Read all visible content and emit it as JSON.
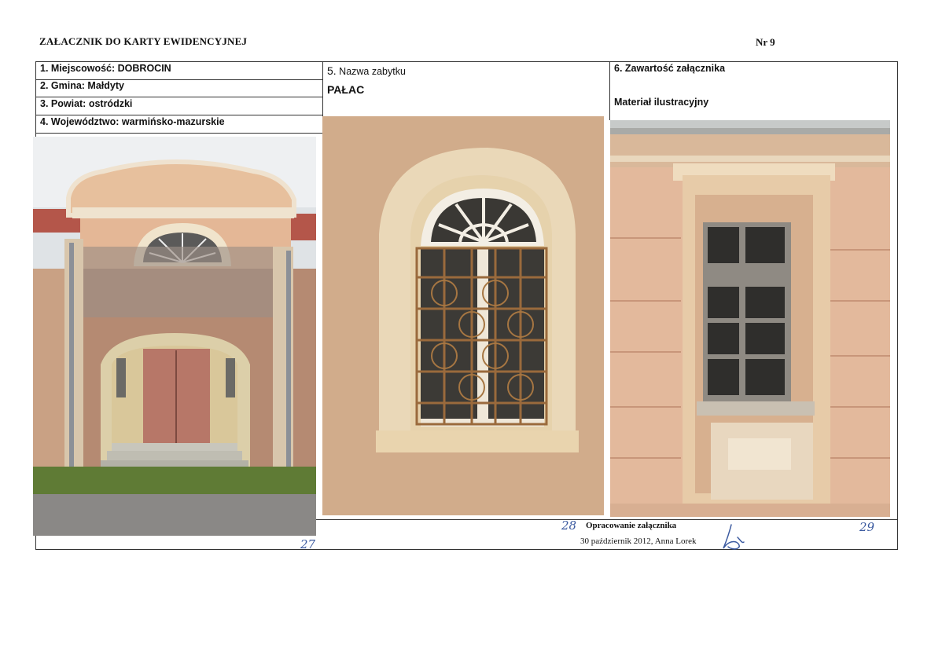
{
  "header": {
    "title": "ZAŁACZNIK DO KARTY EWIDENCYJNEJ",
    "number": "Nr 9"
  },
  "left_info": {
    "f1": "1. Miejscowość: DOBROCIN",
    "f2": "2. Gmina: Małdyty",
    "f3": "3. Powiat: ostródzki",
    "f4": "4. Województwo: warmińsko-mazurskie"
  },
  "monument": {
    "label_num": "5.",
    "label": "Nazwa zabytku",
    "name": "PAŁAC"
  },
  "attachment": {
    "label": "6. Zawartość załącznika",
    "content": "Materiał ilustracyjny"
  },
  "footer": {
    "prepared_label": "Opracowanie załącznika",
    "prepared_by": "30 październik 2012, Anna Lorek"
  },
  "photo_numbers": {
    "p27": "27",
    "p28": "28",
    "p29": "29"
  },
  "photos": [
    {
      "name": "facade-entrance-photo"
    },
    {
      "name": "arched-window-grille-photo"
    },
    {
      "name": "rectangular-window-photo"
    }
  ]
}
